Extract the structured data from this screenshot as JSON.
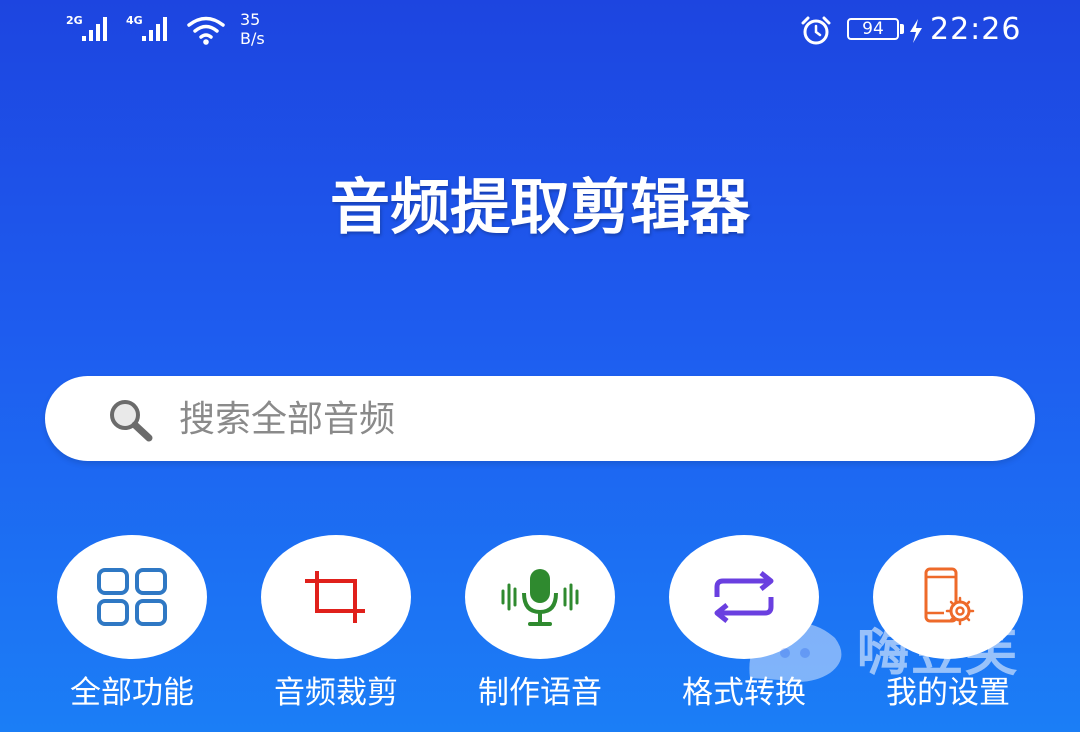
{
  "status_bar": {
    "signal_1": "2G",
    "signal_2": "4G",
    "speed_value": "35",
    "speed_unit": "B/s",
    "battery": "94",
    "time": "22:26"
  },
  "app": {
    "title": "音频提取剪辑器"
  },
  "search": {
    "placeholder": "搜索全部音频"
  },
  "features": [
    {
      "label": "全部功能",
      "icon": "grid-icon",
      "color": "#2f78c4"
    },
    {
      "label": "音频裁剪",
      "icon": "crop-icon",
      "color": "#e0201b"
    },
    {
      "label": "制作语音",
      "icon": "microphone-icon",
      "color": "#2f8a2f"
    },
    {
      "label": "格式转换",
      "icon": "repeat-icon",
      "color": "#6a3fe0"
    },
    {
      "label": "我的设置",
      "icon": "phone-settings-icon",
      "color": "#ee6a2a"
    }
  ],
  "watermark": {
    "text": "嗨豆芙"
  }
}
